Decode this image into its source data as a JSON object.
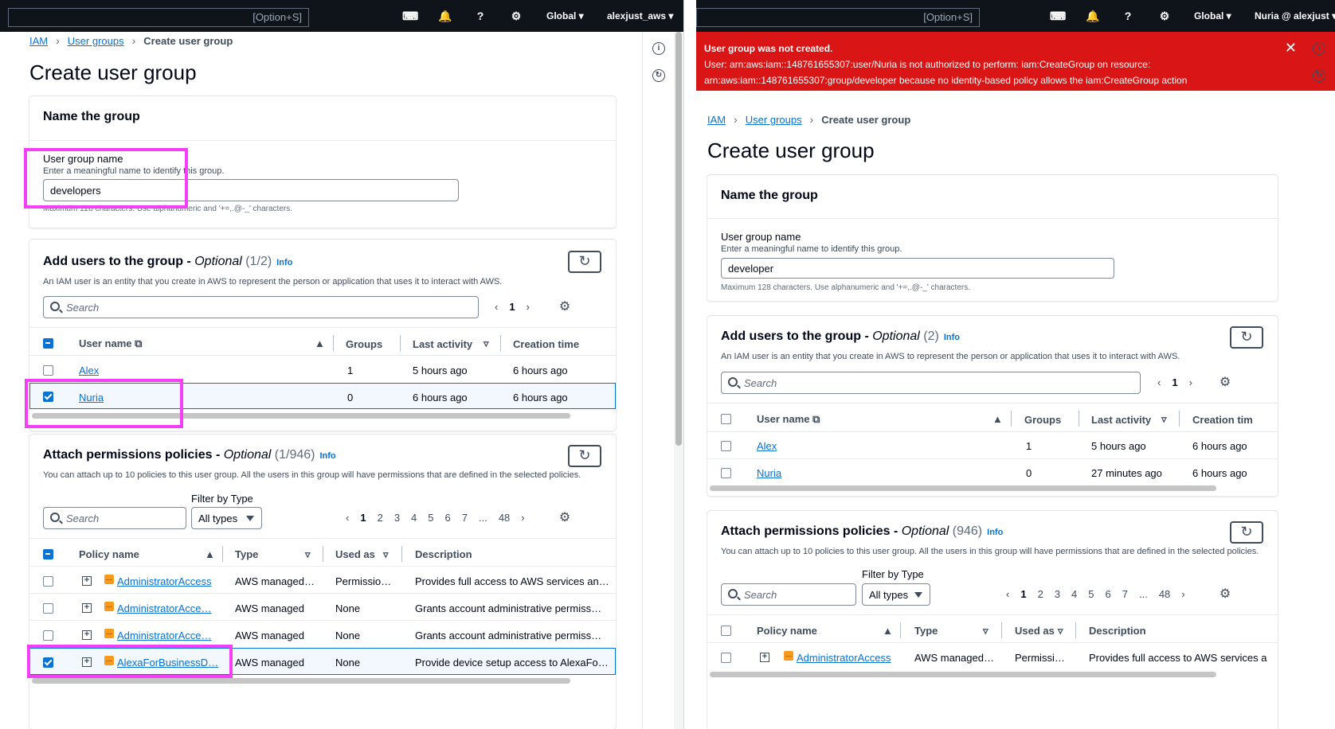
{
  "topbar": {
    "search_hint": "[Option+S]",
    "region": "Global ▾",
    "left_account": "alexjust_aws ▾",
    "right_account": "Nuria @ alexjust ▾"
  },
  "breadcrumb": {
    "root": "IAM",
    "parent": "User groups",
    "current": "Create user group"
  },
  "page_title": "Create user group",
  "left": {
    "name_section": {
      "title": "Name the group",
      "label": "User group name",
      "sublabel": "Enter a meaningful name to identify this group.",
      "value": "developers",
      "hint": "Maximum 128 characters. Use alphanumeric and '+=,.@-_' characters."
    },
    "users_section": {
      "title": "Add users to the group - ",
      "title_opt": "Optional",
      "count": "(1/2)",
      "info": "Info",
      "desc": "An IAM user is an entity that you create in AWS to represent the person or application that uses it to interact with AWS.",
      "search_placeholder": "Search",
      "page": "1",
      "columns": [
        "User name",
        "Groups",
        "Last activity",
        "Creation time"
      ],
      "rows": [
        {
          "name": "Alex",
          "groups": "1",
          "last": "5 hours ago",
          "created": "6 hours ago",
          "checked": false
        },
        {
          "name": "Nuria",
          "groups": "0",
          "last": "6 hours ago",
          "created": "6 hours ago",
          "checked": true
        }
      ]
    },
    "policies_section": {
      "title": "Attach permissions policies - ",
      "title_opt": "Optional",
      "count": "(1/946)",
      "info": "Info",
      "desc": "You can attach up to 10 policies to this user group. All the users in this group will have permissions that are defined in the selected policies.",
      "search_placeholder": "Search",
      "filter_label": "Filter by Type",
      "filter_value": "All types",
      "pages": [
        "1",
        "2",
        "3",
        "4",
        "5",
        "6",
        "7",
        "...",
        "48"
      ],
      "columns": [
        "Policy name",
        "Type",
        "Used as",
        "Description"
      ],
      "rows": [
        {
          "name": "AdministratorAccess",
          "type": "AWS managed …",
          "used": "Permissio…",
          "desc": "Provides full access to AWS services an…",
          "checked": false
        },
        {
          "name": "AdministratorAcce…",
          "type": "AWS managed",
          "used": "None",
          "desc": "Grants account administrative permiss…",
          "checked": false
        },
        {
          "name": "AdministratorAcce…",
          "type": "AWS managed",
          "used": "None",
          "desc": "Grants account administrative permiss…",
          "checked": false
        },
        {
          "name": "AlexaForBusinessD…",
          "type": "AWS managed",
          "used": "None",
          "desc": "Provide device setup access to AlexaFo…",
          "checked": true
        }
      ]
    }
  },
  "right": {
    "error": {
      "title": "User group was not created.",
      "line1": "User: arn:aws:iam::148761655307:user/Nuria is not authorized to perform: iam:CreateGroup on resource:",
      "line2": "arn:aws:iam::148761655307:group/developer because no identity-based policy allows the iam:CreateGroup action"
    },
    "name_section": {
      "title": "Name the group",
      "label": "User group name",
      "sublabel": "Enter a meaningful name to identify this group.",
      "value": "developer",
      "hint": "Maximum 128 characters. Use alphanumeric and '+=,.@-_' characters."
    },
    "users_section": {
      "title": "Add users to the group - ",
      "title_opt": "Optional",
      "count": "(2)",
      "info": "Info",
      "desc": "An IAM user is an entity that you create in AWS to represent the person or application that uses it to interact with AWS.",
      "search_placeholder": "Search",
      "page": "1",
      "columns": [
        "User name",
        "Groups",
        "Last activity",
        "Creation tim"
      ],
      "rows": [
        {
          "name": "Alex",
          "groups": "1",
          "last": "5 hours ago",
          "created": "6 hours ago",
          "checked": false
        },
        {
          "name": "Nuria",
          "groups": "0",
          "last": "27 minutes ago",
          "created": "6 hours ago",
          "checked": false
        }
      ]
    },
    "policies_section": {
      "title": "Attach permissions policies - ",
      "title_opt": "Optional",
      "count": "(946)",
      "info": "Info",
      "desc": "You can attach up to 10 policies to this user group. All the users in this group will have permissions that are defined in the selected policies.",
      "search_placeholder": "Search",
      "filter_label": "Filter by Type",
      "filter_value": "All types",
      "pages": [
        "1",
        "2",
        "3",
        "4",
        "5",
        "6",
        "7",
        "...",
        "48"
      ],
      "columns": [
        "Policy name",
        "Type",
        "Used as",
        "Description"
      ],
      "rows": [
        {
          "name": "AdministratorAccess",
          "type": "AWS managed …",
          "used": "Permissi…",
          "desc": "Provides full access to AWS services a",
          "checked": false
        }
      ]
    }
  },
  "colors": {
    "accent": "#0972d3",
    "error": "#d91515",
    "highlight": "#f53ef8",
    "topbar": "#0f141a"
  }
}
